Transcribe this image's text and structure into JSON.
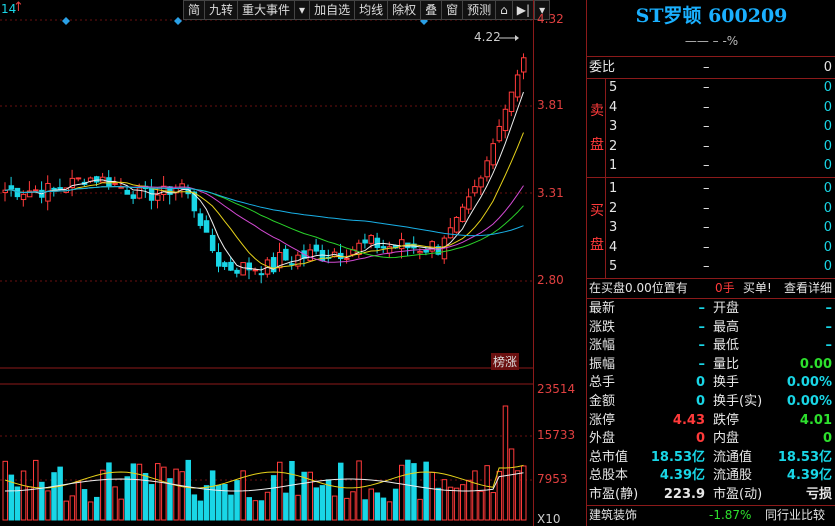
{
  "chart": {
    "top_left_label": "14",
    "toolbar": [
      "简",
      "九转",
      "重大事件",
      "▾",
      "加自选",
      "均线",
      "除权",
      "叠",
      "窗",
      "预测",
      "⌂",
      "▶|",
      "▾"
    ],
    "price_ticks": [
      "4.32",
      "3.81",
      "3.31",
      "2.80"
    ],
    "vol_ticks": [
      "23514",
      "15733",
      "7953"
    ],
    "vol_unit": "X10",
    "max_label": "4.22",
    "tag": "榜涨"
  },
  "quote": {
    "title": "ST罗顿 600209",
    "sub_line": "—— – -%",
    "weibi": {
      "label": "委比",
      "val1": "–",
      "val2": "0"
    },
    "sell": {
      "side": "卖盘",
      "rows": [
        {
          "n": "5",
          "p": "–",
          "v": "0"
        },
        {
          "n": "4",
          "p": "–",
          "v": "0"
        },
        {
          "n": "3",
          "p": "–",
          "v": "0"
        },
        {
          "n": "2",
          "p": "–",
          "v": "0"
        },
        {
          "n": "1",
          "p": "–",
          "v": "0"
        }
      ]
    },
    "buy": {
      "side": "买盘",
      "rows": [
        {
          "n": "1",
          "p": "–",
          "v": "0"
        },
        {
          "n": "2",
          "p": "–",
          "v": "0"
        },
        {
          "n": "3",
          "p": "–",
          "v": "0"
        },
        {
          "n": "4",
          "p": "–",
          "v": "0"
        },
        {
          "n": "5",
          "p": "–",
          "v": "0"
        }
      ]
    },
    "status_bar": {
      "text": "在买盘0.00位置有",
      "qty": "0手",
      "buy_btn": "买单!",
      "detail_btn": "查看详细"
    },
    "stats": [
      {
        "l1": "最新",
        "v1": "–",
        "l2": "开盘",
        "v2": "–"
      },
      {
        "l1": "涨跌",
        "v1": "–",
        "l2": "最高",
        "v2": "–"
      },
      {
        "l1": "涨幅",
        "v1": "–",
        "l2": "最低",
        "v2": "–"
      },
      {
        "l1": "振幅",
        "v1": "–",
        "l2": "量比",
        "v2": "0.00"
      },
      {
        "l1": "总手",
        "v1": "0",
        "l2": "换手",
        "v2": "0.00%"
      },
      {
        "l1": "金额",
        "v1": "0",
        "l2": "换手(实)",
        "v2": "0.00%"
      },
      {
        "l1": "涨停",
        "v1": "4.43",
        "l2": "跌停",
        "v2": "4.01"
      },
      {
        "l1": "外盘",
        "v1": "0",
        "l2": "内盘",
        "v2": "0"
      },
      {
        "l1": "总市值",
        "v1": "18.53亿",
        "l2": "流通值",
        "v2": "18.53亿"
      },
      {
        "l1": "总股本",
        "v1": "4.39亿",
        "l2": "流通股",
        "v2": "4.39亿"
      },
      {
        "l1": "市盈(静)",
        "v1": "223.9",
        "l2": "市盈(动)",
        "v2": "亏损"
      }
    ],
    "industry": {
      "name": "建筑装饰",
      "change": "-1.87%",
      "compare": "同行业比较"
    }
  }
}
